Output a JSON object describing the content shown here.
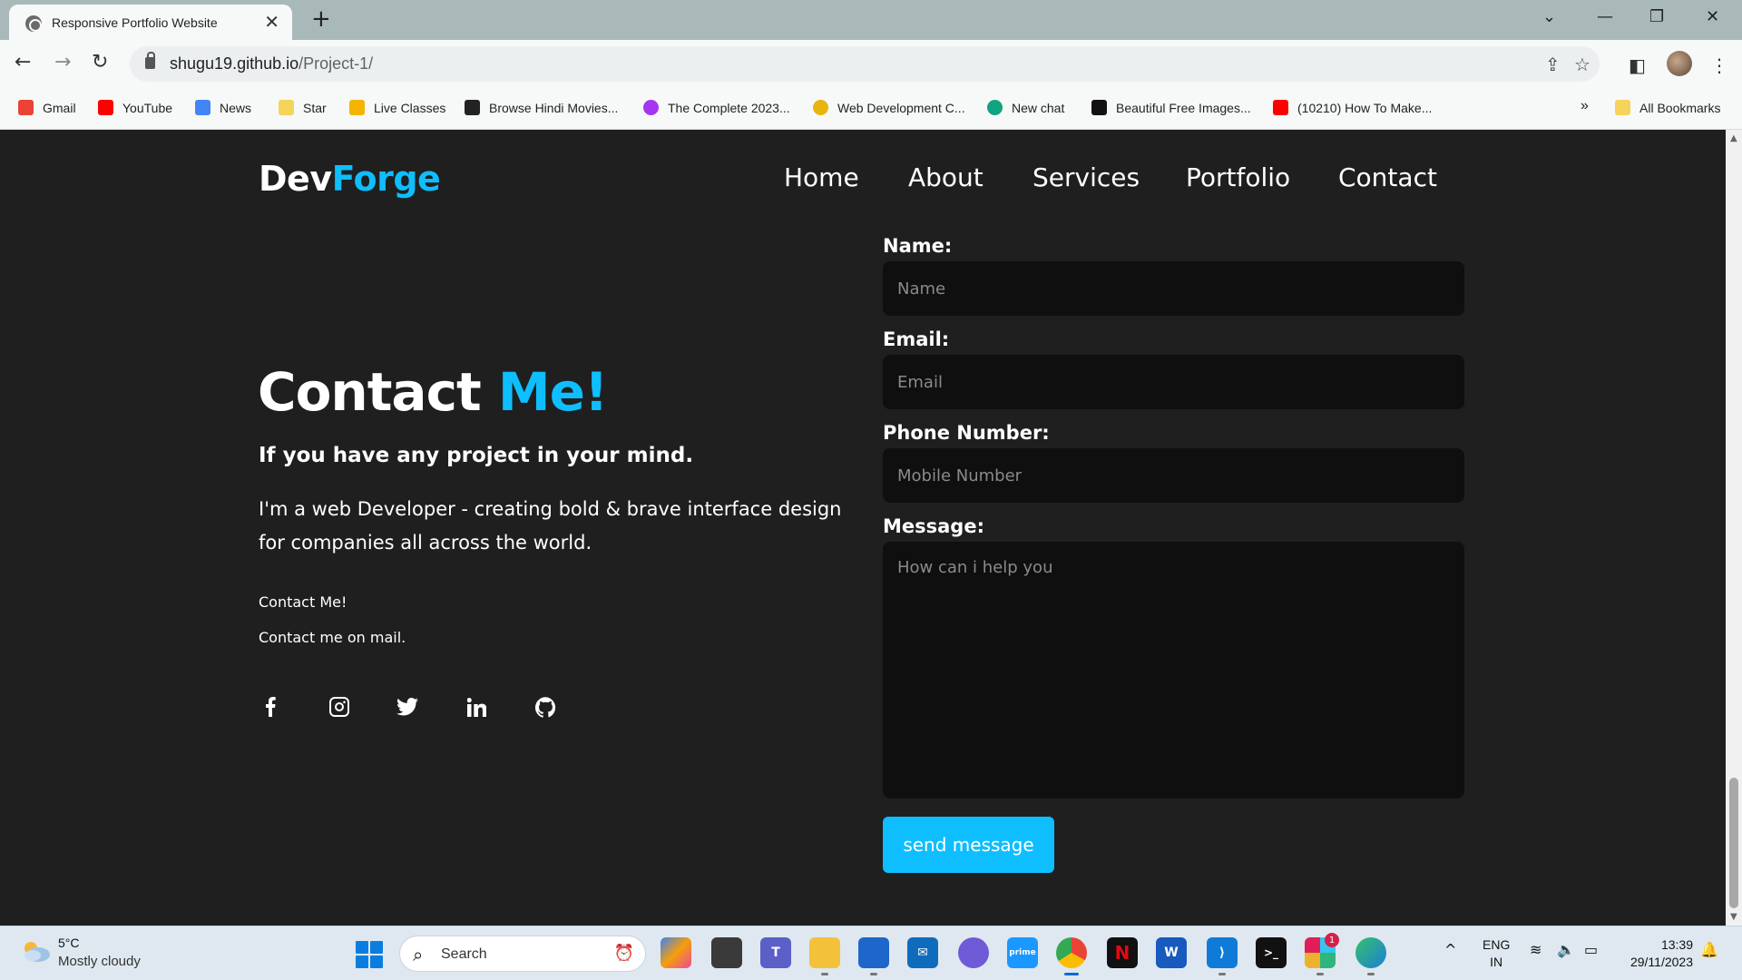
{
  "browser": {
    "tab_title": "Responsive Portfolio Website",
    "tab_close": "✕",
    "new_tab": "+",
    "url_host": "shugu19.github.io",
    "url_path": "/Project-1/",
    "bookmarks": [
      {
        "label": "Gmail",
        "color": "#ea4335"
      },
      {
        "label": "YouTube",
        "color": "#ff0000"
      },
      {
        "label": "News",
        "color": "#4285f4"
      },
      {
        "label": "Star",
        "color": "#f6d35b"
      },
      {
        "label": "Live Classes",
        "color": "#f4b400"
      },
      {
        "label": "Browse Hindi Movies...",
        "color": "#222222"
      },
      {
        "label": "The Complete 2023...",
        "color": "#a435f0"
      },
      {
        "label": "Web Development C...",
        "color": "#e8b40e"
      },
      {
        "label": "New chat",
        "color": "#10a37f"
      },
      {
        "label": "Beautiful Free Images...",
        "color": "#111111"
      },
      {
        "label": "(10210) How To Make...",
        "color": "#ff0000"
      }
    ],
    "more_bookmarks": "»",
    "all_bookmarks": "All Bookmarks"
  },
  "site": {
    "logo_main": "Dev",
    "logo_accent": "Forge",
    "nav": [
      "Home",
      "About",
      "Services",
      "Portfolio",
      "Contact"
    ],
    "heading_main": "Contact",
    "heading_accent": "Me!",
    "subheading": "If you have any project in your mind.",
    "intro": "I'm a web Developer - creating bold & brave interface design for companies all across the world.",
    "contact_line1": "Contact Me!",
    "contact_line2": "Contact me on mail.",
    "social_icons": [
      "facebook-icon",
      "instagram-icon",
      "twitter-icon",
      "linkedin-icon",
      "github-icon"
    ],
    "accent_color": "#0ebeff",
    "form": {
      "name_label": "Name:",
      "name_placeholder": "Name",
      "email_label": "Email:",
      "email_placeholder": "Email",
      "phone_label": "Phone Number:",
      "phone_placeholder": "Mobile Number",
      "message_label": "Message:",
      "message_placeholder": "How can i help you",
      "submit_label": "send message"
    }
  },
  "taskbar": {
    "weather_temp": "5°C",
    "weather_desc": "Mostly cloudy",
    "search_placeholder": "Search",
    "lang_line1": "ENG",
    "lang_line2": "IN",
    "time": "13:39",
    "date": "29/11/2023",
    "slack_badge": "1"
  }
}
